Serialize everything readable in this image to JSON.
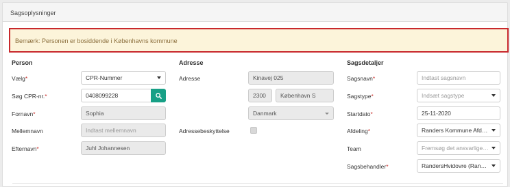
{
  "panel": {
    "title": "Sagsoplysninger"
  },
  "alert": {
    "text": "Bemærk: Personen er bosiddende i Københavns kommune"
  },
  "person": {
    "title": "Person",
    "vaelg_label": "Vælg",
    "vaelg_value": "CPR-Nummer",
    "cpr_label": "Søg CPR-nr.",
    "cpr_value": "0408099228",
    "fornavn_label": "Fornavn",
    "fornavn_value": "Sophia",
    "mellemnavn_label": "Mellemnavn",
    "mellemnavn_placeholder": "Indtast mellemnavn",
    "efternavn_label": "Efternavn",
    "efternavn_value": "Juhl Johannesen",
    "required_mark": "*"
  },
  "adresse": {
    "title": "Adresse",
    "adresse_label": "Adresse",
    "street_value": "Kinavej 025",
    "postal_value": "2300",
    "city_value": "København S",
    "country_value": "Danmark",
    "beskyttelse_label": "Adressebeskyttelse"
  },
  "sag": {
    "title": "Sagsdetaljer",
    "sagsnavn_label": "Sagsnavn",
    "sagsnavn_placeholder": "Indtast sagsnavn",
    "sagstype_label": "Sagstype",
    "sagstype_value": "Indsæt sagstype",
    "startdato_label": "Startdato",
    "startdato_value": "25-11-2020",
    "afdeling_label": "Afdeling",
    "afdeling_value": "Randers Kommune Afdelin...",
    "team_label": "Team",
    "team_placeholder": "Fremsøg det ansvarlige te...",
    "behandler_label": "Sagsbehandler",
    "behandler_value": "RandersHvidovre (Randers...",
    "required_mark": "*"
  }
}
